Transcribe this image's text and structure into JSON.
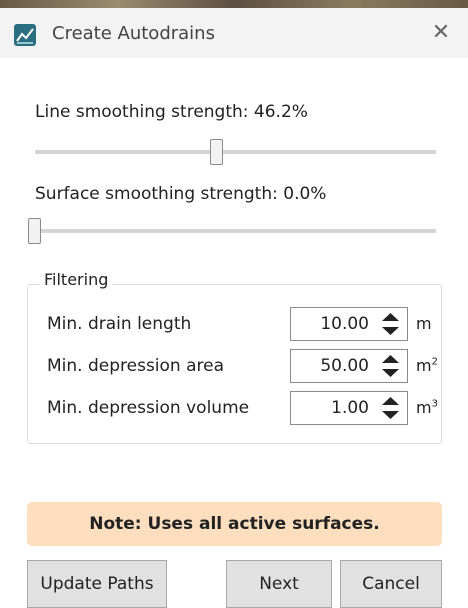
{
  "window": {
    "title": "Create Autodrains",
    "close_glyph": "✕",
    "app_icon": "autodrains-app-icon"
  },
  "line_smoothing": {
    "label": "Line smoothing strength: 46.2%",
    "value_fraction": 0.462
  },
  "surface_smoothing": {
    "label": "Surface smoothing strength: 0.0%",
    "value_fraction": 0.0
  },
  "filtering": {
    "title": "Filtering",
    "rows": [
      {
        "label": "Min. drain length",
        "value": "10.00",
        "unit": "m",
        "unit_sup": ""
      },
      {
        "label": "Min. depression area",
        "value": "50.00",
        "unit": "m",
        "unit_sup": "2"
      },
      {
        "label": "Min. depression volume",
        "value": "1.00",
        "unit": "m",
        "unit_sup": "3"
      }
    ]
  },
  "note": {
    "text": "Note: Uses all active surfaces.",
    "background": "#fddfc0"
  },
  "buttons": {
    "update": "Update Paths",
    "next": "Next",
    "cancel": "Cancel"
  }
}
